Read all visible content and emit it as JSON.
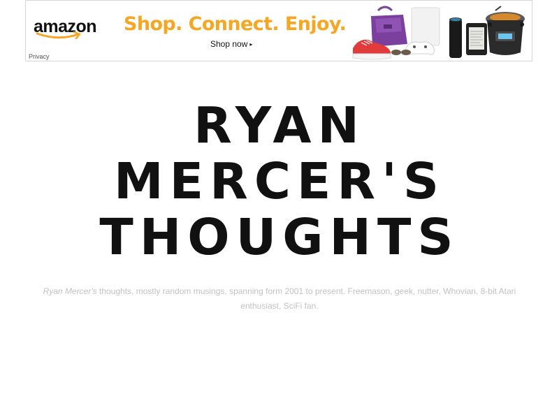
{
  "ad": {
    "brand": "amazon",
    "headline": "Shop. Connect. Enjoy.",
    "cta": "Shop now",
    "privacy": "Privacy",
    "colors": {
      "headline": "#f5a623",
      "smile": "#f5a623"
    },
    "products": [
      "sneaker-icon",
      "handbag-icon",
      "router-icon",
      "game-controller-icon",
      "smart-speaker-icon",
      "e-reader-icon",
      "slow-cooker-icon"
    ]
  },
  "site": {
    "title_lines": [
      "RYAN",
      "MERCER'S",
      "THOUGHTS"
    ],
    "tagline_author": "Ryan Mercer's",
    "tagline_line1_rest": " thoughts, mostly random musings, spanning form 2001 to present. Freemason, geek, nutter, Whovian, 8-bit Atari",
    "tagline_line2": "enthusiast, SciFi fan."
  }
}
